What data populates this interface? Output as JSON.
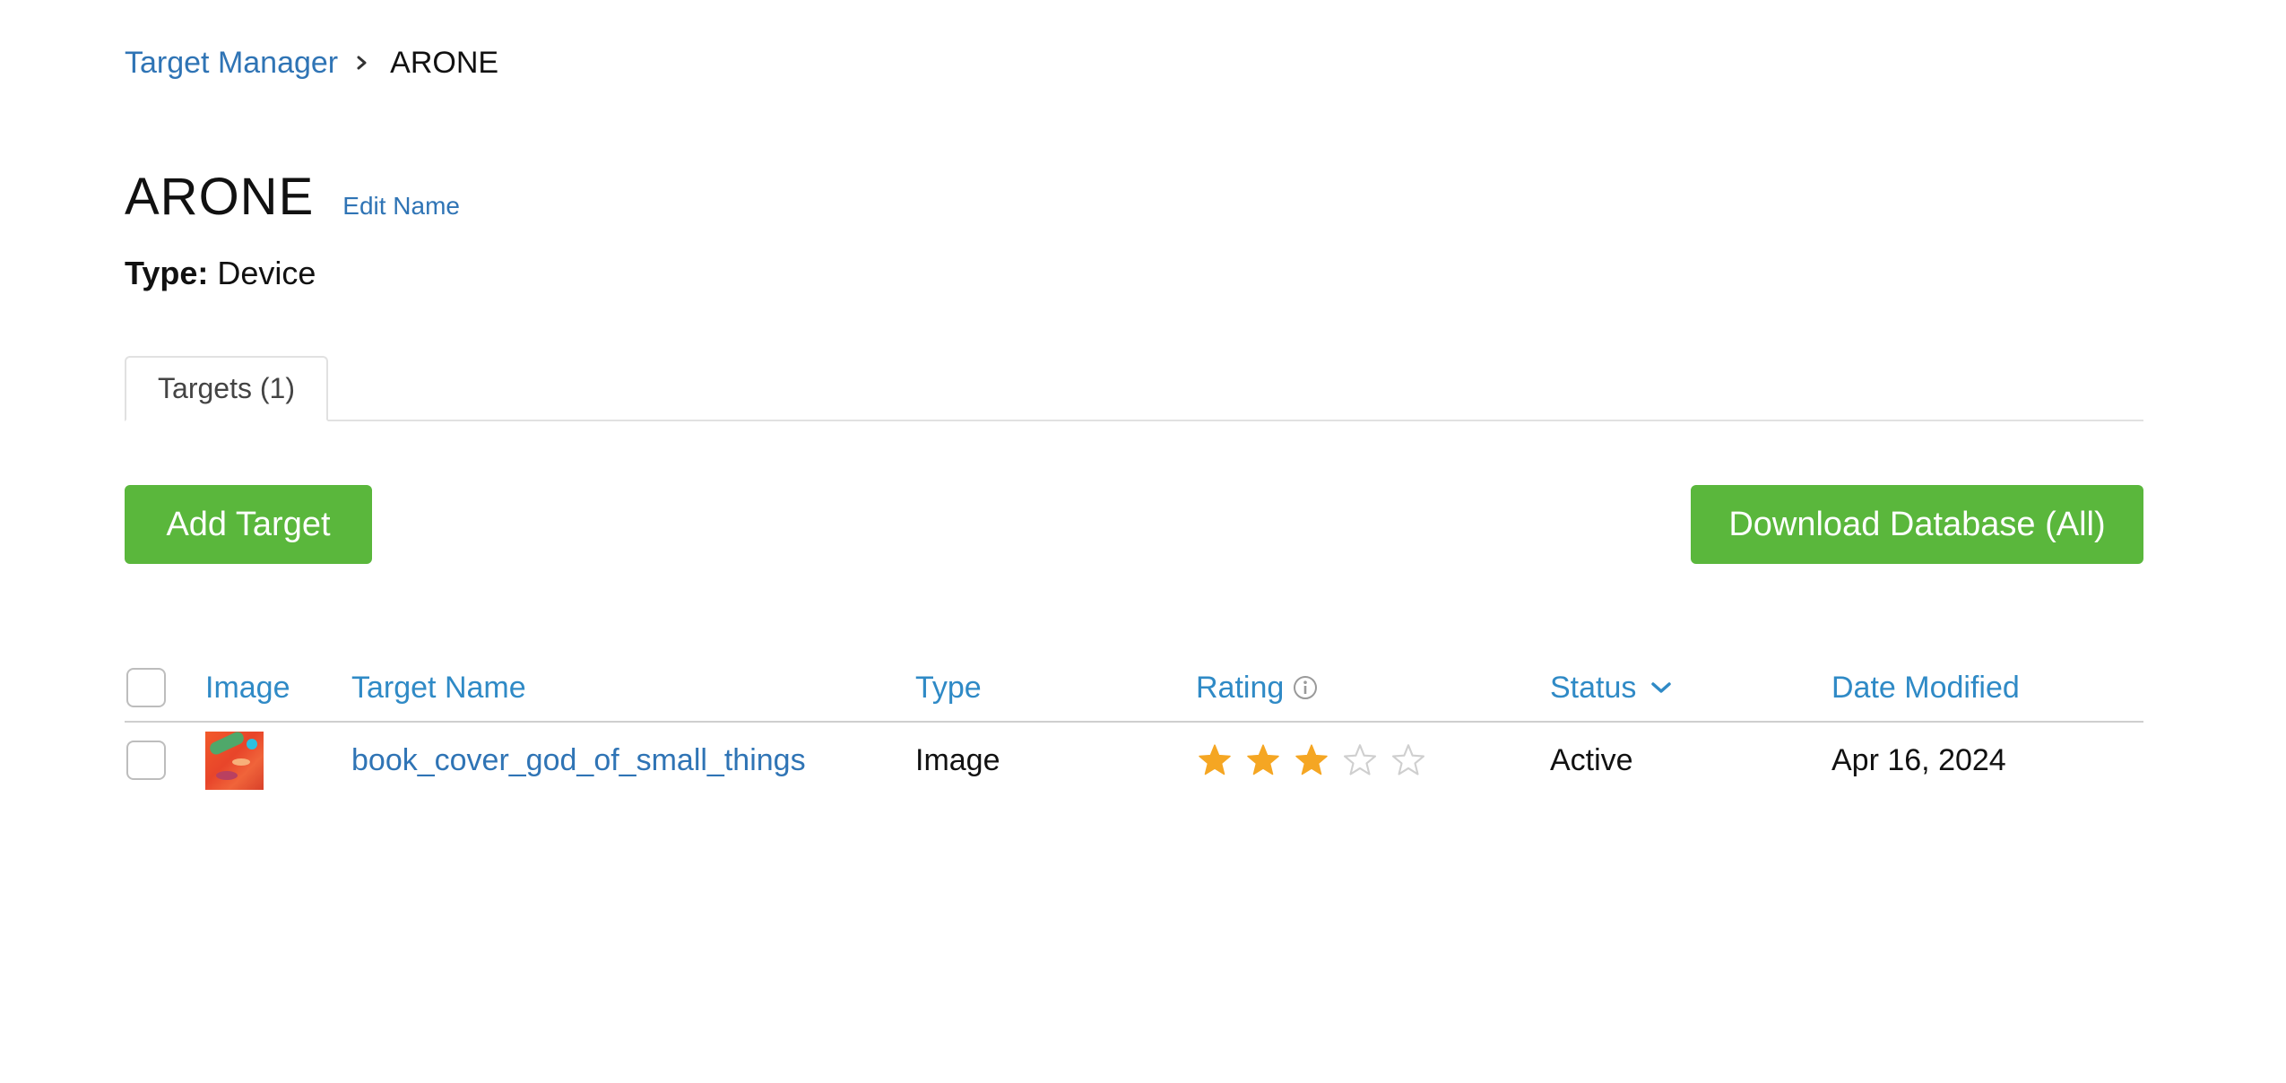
{
  "breadcrumb": {
    "root": "Target Manager",
    "current": "ARONE"
  },
  "header": {
    "title": "ARONE",
    "edit_name": "Edit Name",
    "type_label": "Type:",
    "type_value": "Device"
  },
  "tabs": [
    {
      "label": "Targets (1)",
      "active": true
    }
  ],
  "actions": {
    "add_target": "Add Target",
    "download_database": "Download Database (All)"
  },
  "table": {
    "columns": {
      "image": "Image",
      "target_name": "Target Name",
      "type": "Type",
      "rating": "Rating",
      "status": "Status",
      "date_modified": "Date Modified"
    },
    "rows": [
      {
        "target_name": "book_cover_god_of_small_things",
        "type": "Image",
        "rating": 3,
        "rating_max": 5,
        "status": "Active",
        "date_modified": "Apr 16, 2024"
      }
    ]
  },
  "colors": {
    "link": "#2f74b5",
    "header_link": "#2f8ac6",
    "button_green": "#5ab73c",
    "star_filled": "#f5a623",
    "star_empty": "#cfcfcf"
  },
  "icons": {
    "breadcrumb_separator": "chevron-right-icon",
    "rating_info": "info-icon",
    "status_sort": "chevron-down-icon",
    "rating_star": "star-icon"
  }
}
